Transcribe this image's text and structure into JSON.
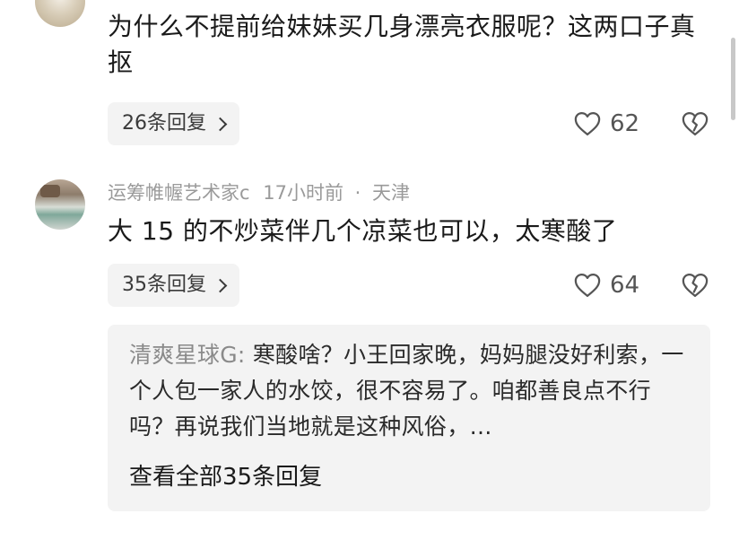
{
  "comment1": {
    "text": "为什么不提前给妹妹买几身漂亮衣服呢？这两口子真抠",
    "replies_label": "26条回复",
    "likes": "62"
  },
  "comment2": {
    "author": "运筹帷幄艺术家c",
    "time": "17小时前",
    "separator": "·",
    "location": "天津",
    "text": "大 15 的不炒菜伴几个凉菜也可以，太寒酸了",
    "replies_label": "35条回复",
    "likes": "64",
    "top_reply": {
      "author": "清爽星球G",
      "colon": ":",
      "text": "寒酸啥？小王回家晚，妈妈腿没好利索，一个人包一家人的水饺，很不容易了。咱都善良点不行吗？再说我们当地就是这种风俗，…",
      "view_all_label": "查看全部35条回复"
    }
  },
  "icons": {
    "like": "heart-outline-icon",
    "dislike": "broken-heart-icon",
    "reply_chevron": "chevron-right-icon"
  },
  "colors": {
    "text_primary": "#1a1a1a",
    "text_meta": "#9a9a9a",
    "reply_bg": "#f3f3f3"
  }
}
